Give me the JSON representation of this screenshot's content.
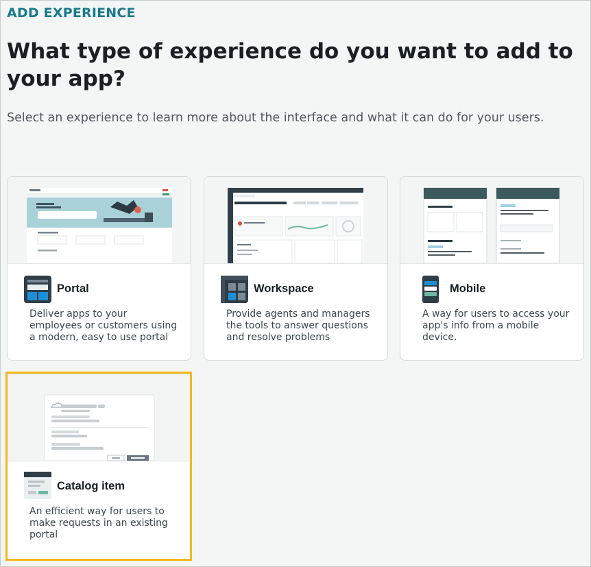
{
  "header": {
    "eyebrow": "ADD EXPERIENCE",
    "title": "What type of experience do you want to add to your app?",
    "subtitle": "Select an experience to learn more about the interface and what it can do for your users."
  },
  "cards": [
    {
      "name": "Portal",
      "description": "Deliver apps to your employees or customers using a modern, easy to use portal",
      "icon": "portal-icon"
    },
    {
      "name": "Workspace",
      "description": "Provide agents and managers the tools to answer questions and resolve problems",
      "icon": "workspace-icon"
    },
    {
      "name": "Mobile",
      "description": "A way for users to access your app's info from a mobile device.",
      "icon": "mobile-icon"
    },
    {
      "name": "Catalog item",
      "description": "An efficient way for users to make requests in an existing portal",
      "icon": "catalog-item-icon",
      "selected": true
    }
  ],
  "colors": {
    "accent": "#1a7a8c",
    "selection": "#f5b819",
    "icon_dark": "#2f3d47",
    "icon_blue": "#1e8fd6",
    "icon_green": "#6fb8a0"
  }
}
